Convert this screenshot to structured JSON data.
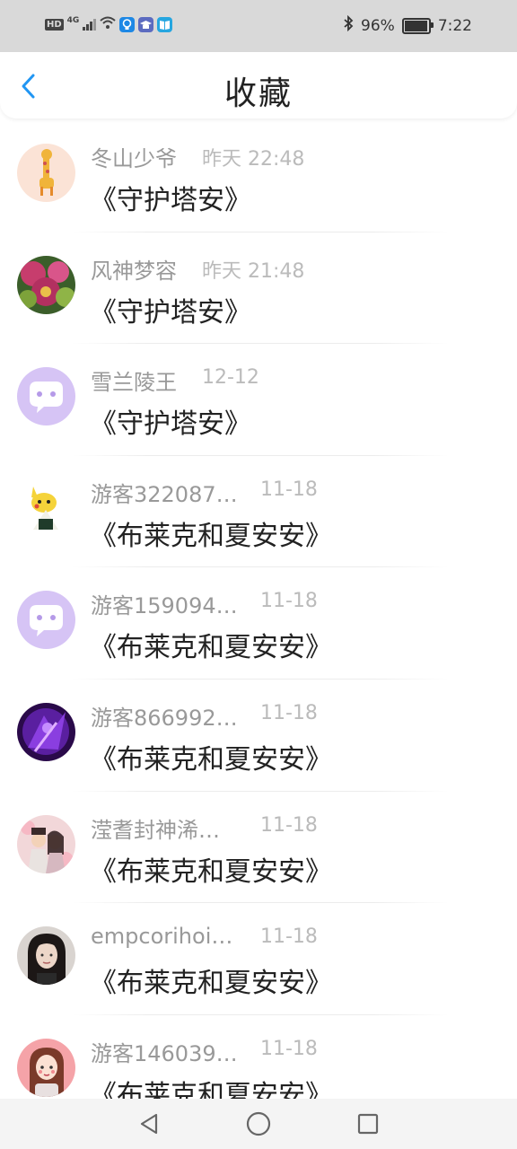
{
  "status_bar": {
    "hd": "HD",
    "network": "4G",
    "battery_percent": "96%",
    "battery_level": 0.96,
    "time": "7:22",
    "icons": [
      "hd-icon",
      "signal-icon",
      "wifi-icon",
      "bulb-app-icon",
      "graduation-app-icon",
      "book-app-icon",
      "bluetooth-icon",
      "battery-icon"
    ]
  },
  "header": {
    "title": "收藏",
    "back_icon": "chevron-left-icon",
    "accent": "#2196f3"
  },
  "favorites": [
    {
      "name": "冬山少爷",
      "time": "昨天 22:48",
      "title": "《守护塔安》",
      "avatar": "giraffe-avatar"
    },
    {
      "name": "风神梦容",
      "time": "昨天 21:48",
      "title": "《守护塔安》",
      "avatar": "flower-avatar"
    },
    {
      "name": "雪兰陵王",
      "time": "12-12",
      "title": "《守护塔安》",
      "avatar": "default-chat-avatar"
    },
    {
      "name": "游客322087…",
      "time": "11-18",
      "title": "《布莱克和夏安安》",
      "avatar": "pikachu-avatar"
    },
    {
      "name": "游客159094…",
      "time": "11-18",
      "title": "《布莱克和夏安安》",
      "avatar": "default-chat-avatar"
    },
    {
      "name": "游客866992…",
      "time": "11-18",
      "title": "《布莱克和夏安安》",
      "avatar": "purple-hero-avatar"
    },
    {
      "name": "滢耆封神浠…",
      "time": "11-18",
      "title": "《布莱克和夏安安》",
      "avatar": "couple-avatar"
    },
    {
      "name": "empcorihoi…",
      "time": "11-18",
      "title": "《布莱克和夏安安》",
      "avatar": "girl-photo-avatar"
    },
    {
      "name": "游客146039…",
      "time": "11-18",
      "title": "《布莱克和夏安安》",
      "avatar": "cartoon-girl-avatar"
    }
  ],
  "nav_bar": {
    "icons": [
      "back-triangle-icon",
      "home-circle-icon",
      "recents-square-icon"
    ]
  }
}
